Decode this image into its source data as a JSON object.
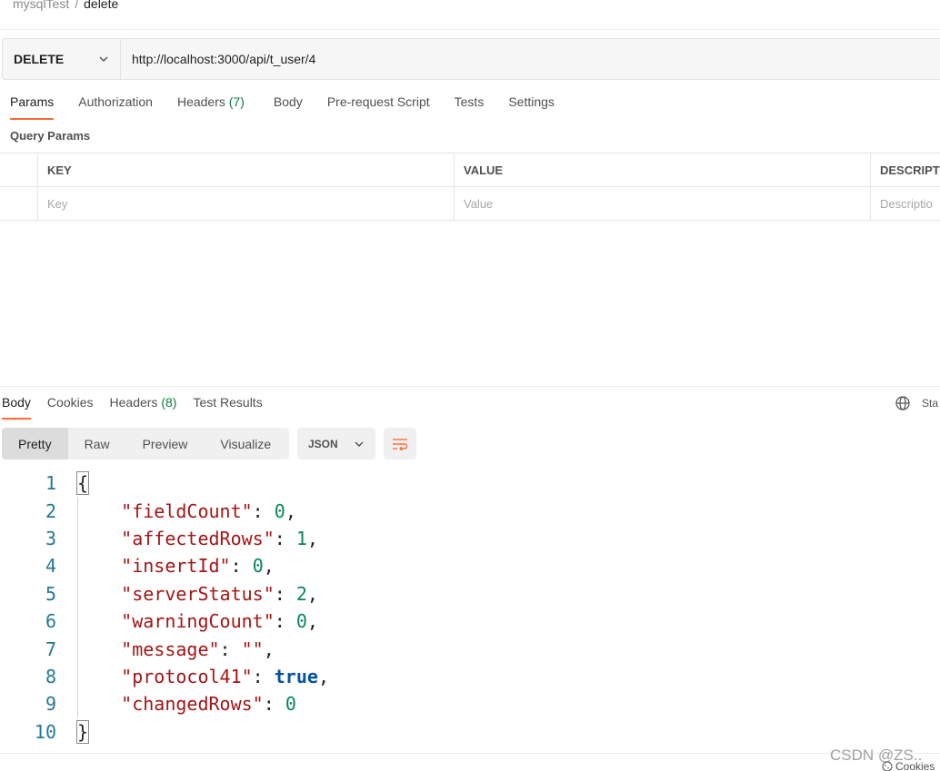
{
  "breadcrumb": {
    "collection": "mysqlTest",
    "separator": "/",
    "request": "delete"
  },
  "request": {
    "method": "DELETE",
    "url": "http://localhost:3000/api/t_user/4"
  },
  "request_tabs": [
    {
      "label": "Params",
      "count": null,
      "active": true
    },
    {
      "label": "Authorization",
      "count": null,
      "active": false
    },
    {
      "label": "Headers",
      "count": "(7)",
      "active": false
    },
    {
      "label": "Body",
      "count": null,
      "active": false
    },
    {
      "label": "Pre-request Script",
      "count": null,
      "active": false
    },
    {
      "label": "Tests",
      "count": null,
      "active": false
    },
    {
      "label": "Settings",
      "count": null,
      "active": false
    }
  ],
  "query_params": {
    "title": "Query Params",
    "headers": {
      "key": "KEY",
      "value": "VALUE",
      "description": "DESCRIPT"
    },
    "placeholders": {
      "key": "Key",
      "value": "Value",
      "description": "Descriptio"
    }
  },
  "response_tabs": [
    {
      "label": "Body",
      "count": null,
      "active": true
    },
    {
      "label": "Cookies",
      "count": null,
      "active": false
    },
    {
      "label": "Headers",
      "count": "(8)",
      "active": false
    },
    {
      "label": "Test Results",
      "count": null,
      "active": false
    }
  ],
  "status_truncated": "Sta",
  "view_modes": [
    {
      "label": "Pretty",
      "active": true
    },
    {
      "label": "Raw",
      "active": false
    },
    {
      "label": "Preview",
      "active": false
    },
    {
      "label": "Visualize",
      "active": false
    }
  ],
  "format": "JSON",
  "response_body": {
    "open_brace": "{",
    "close_brace": "}",
    "fields": [
      {
        "key": "\"fieldCount\"",
        "value": "0",
        "type": "number",
        "comma": true
      },
      {
        "key": "\"affectedRows\"",
        "value": "1",
        "type": "number",
        "comma": true
      },
      {
        "key": "\"insertId\"",
        "value": "0",
        "type": "number",
        "comma": true
      },
      {
        "key": "\"serverStatus\"",
        "value": "2",
        "type": "number",
        "comma": true
      },
      {
        "key": "\"warningCount\"",
        "value": "0",
        "type": "number",
        "comma": true
      },
      {
        "key": "\"message\"",
        "value": "\"\"",
        "type": "string",
        "comma": true
      },
      {
        "key": "\"protocol41\"",
        "value": "true",
        "type": "bool",
        "comma": true
      },
      {
        "key": "\"changedRows\"",
        "value": "0",
        "type": "number",
        "comma": false
      }
    ],
    "line_numbers": [
      "1",
      "2",
      "3",
      "4",
      "5",
      "6",
      "7",
      "8",
      "9",
      "10"
    ]
  },
  "footer": {
    "watermark": "CSDN @ZS..",
    "cookies": "Cookies"
  },
  "colors": {
    "accent": "#ff6c37",
    "count_green": "#0f7b3f",
    "json_key": "#a31515",
    "json_number": "#098658",
    "json_bool": "#0451a5"
  }
}
